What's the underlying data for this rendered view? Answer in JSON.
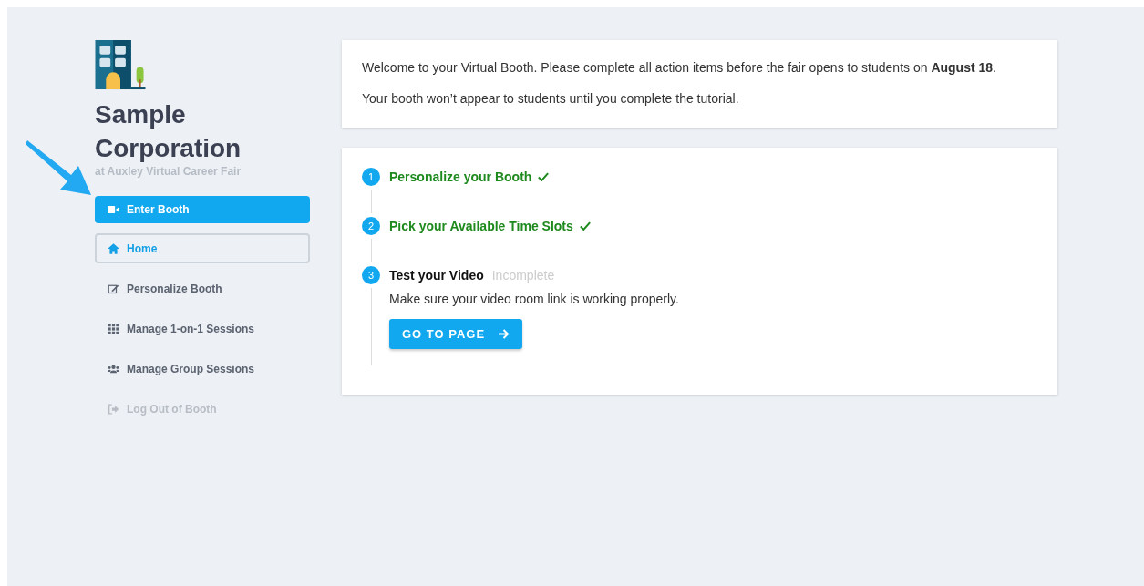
{
  "company": {
    "name": "Sample Corporation",
    "subtitle": "at Auxley Virtual Career Fair"
  },
  "nav": [
    {
      "label": "Enter Booth",
      "kind": "primary",
      "selected": false,
      "disabled": false
    },
    {
      "label": "Home",
      "kind": "item",
      "selected": true,
      "disabled": false
    },
    {
      "label": "Personalize Booth",
      "kind": "item",
      "selected": false,
      "disabled": false
    },
    {
      "label": "Manage 1-on-1 Sessions",
      "kind": "item",
      "selected": false,
      "disabled": false
    },
    {
      "label": "Manage Group Sessions",
      "kind": "item",
      "selected": false,
      "disabled": false
    },
    {
      "label": "Log Out of Booth",
      "kind": "item",
      "selected": false,
      "disabled": true
    }
  ],
  "welcome": [
    "Welcome to your Virtual Booth. Please complete all action items before the fair opens to students on **August 18**.",
    "Your booth won’t appear to students until you complete the tutorial."
  ],
  "steps": [
    {
      "number": "1",
      "title": "Personalize your Booth",
      "complete": true
    },
    {
      "number": "2",
      "title": "Pick your Available Time Slots",
      "complete": true
    },
    {
      "number": "3",
      "title": "Test your Video",
      "complete": false,
      "status": "Incomplete",
      "description": "Make sure your video room link is working properly.",
      "button": "GO TO PAGE"
    }
  ]
}
